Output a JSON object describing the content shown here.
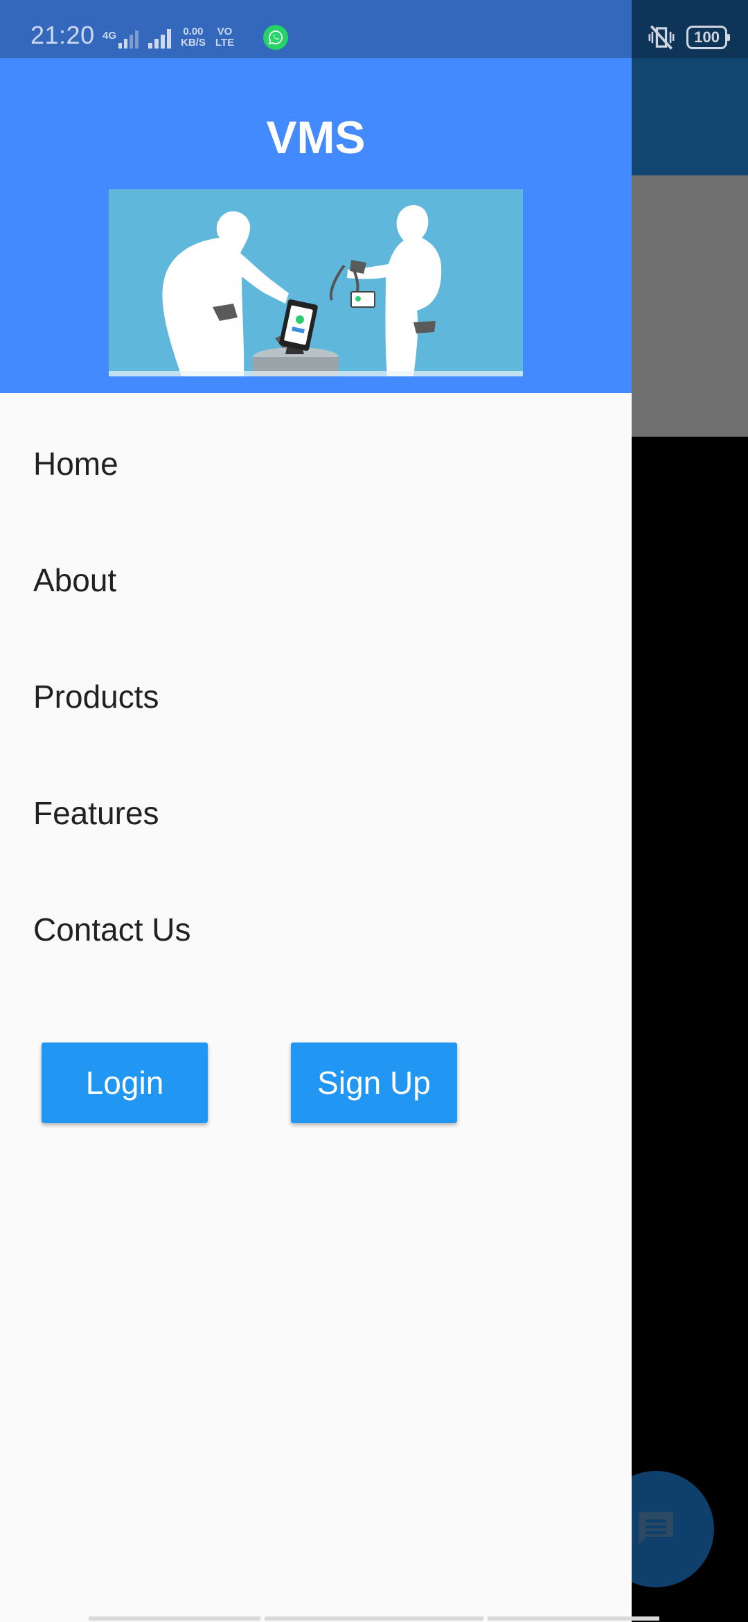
{
  "status_bar": {
    "time": "21:20",
    "network_type": "4G",
    "speed_value": "0.00",
    "speed_unit": "KB/S",
    "volte_top": "VO",
    "volte_bottom": "LTE",
    "battery": "100"
  },
  "drawer": {
    "title": "VMS",
    "hero_image_alt": "visitor check-in illustration",
    "nav_items": [
      {
        "label": "Home"
      },
      {
        "label": "About"
      },
      {
        "label": "Products"
      },
      {
        "label": "Features"
      },
      {
        "label": "Contact Us"
      }
    ],
    "login_label": "Login",
    "signup_label": "Sign Up"
  },
  "colors": {
    "header_blue": "#448aff",
    "button_blue": "#2196f3",
    "drawer_bg": "#fafafa",
    "statusbar_blue": "#3368bd"
  },
  "icons": {
    "whatsapp": "whatsapp-icon",
    "mute": "vibrate-mute-icon",
    "chat": "chat-icon"
  }
}
